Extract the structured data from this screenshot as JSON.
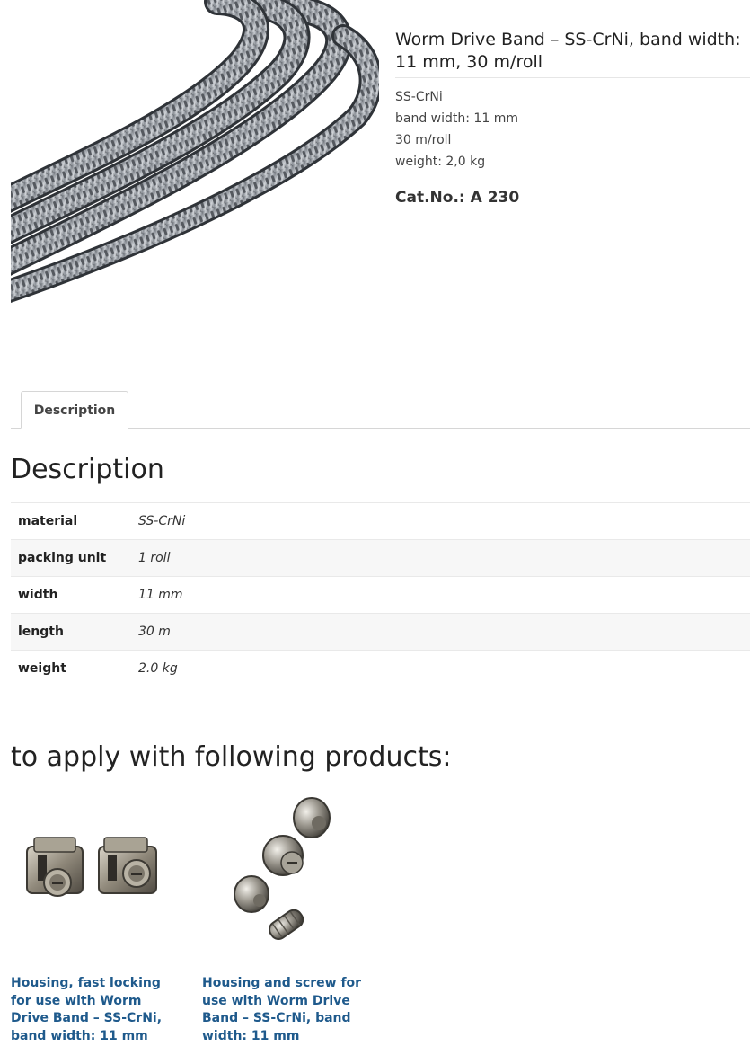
{
  "product": {
    "title": "Worm Drive Band – SS-CrNi, band width: 11 mm, 30 m/roll",
    "short_description": [
      "SS-CrNi",
      "band width: 11 mm",
      "30 m/roll",
      "weight: 2,0 kg"
    ],
    "cat_no": "Cat.No.: A 230",
    "image_icon": "steel-band-roll-photo"
  },
  "tabs": [
    {
      "label": "Description",
      "active": true
    }
  ],
  "description": {
    "heading": "Description",
    "attributes": [
      {
        "label": "material",
        "value": "SS-CrNi"
      },
      {
        "label": "packing unit",
        "value": "1 roll"
      },
      {
        "label": "width",
        "value": "11 mm"
      },
      {
        "label": "length",
        "value": "30 m"
      },
      {
        "label": "weight",
        "value": "2.0 kg"
      }
    ]
  },
  "related": {
    "heading": "to apply with following products:",
    "items": [
      {
        "title": "Housing, fast locking for use with Worm Drive Band – SS-CrNi, band width: 11 mm",
        "image_icon": "housing-fast-locking-photo"
      },
      {
        "title": "Housing and screw for use with Worm Drive Band – SS-CrNi, band width: 11 mm",
        "image_icon": "housing-and-screw-photo"
      }
    ]
  },
  "colors": {
    "link": "#1f5a8c",
    "heading": "#222222",
    "border": "#d6d6d6",
    "row_alt": "#f7f7f7"
  }
}
